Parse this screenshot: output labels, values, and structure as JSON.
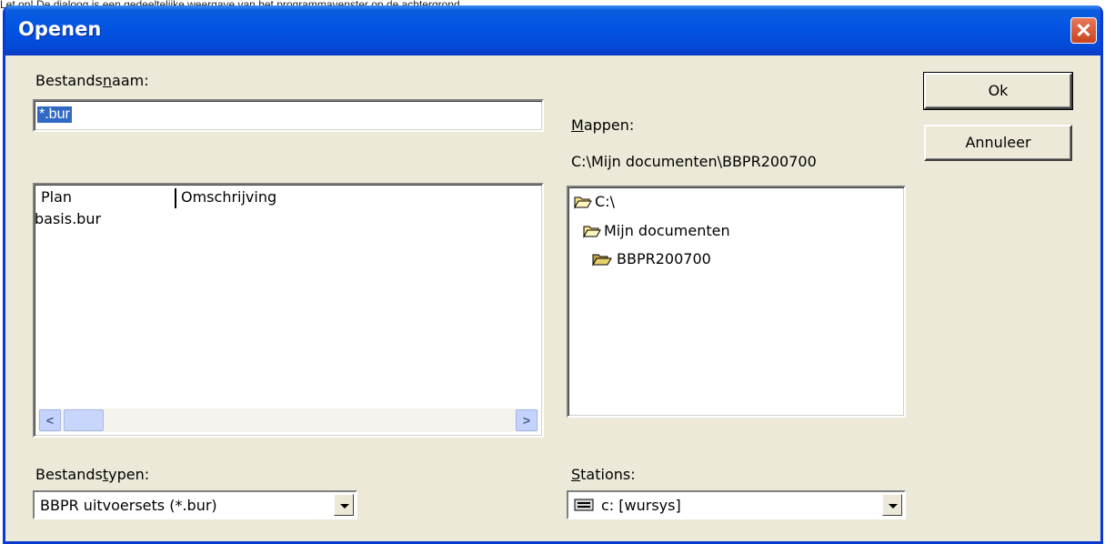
{
  "top_strip_text": "Let op! De dialoog is een gedeeltelijke weergave van het programmavenster op de achtergrond",
  "window": {
    "title": "Openen"
  },
  "filename": {
    "label_pre": "Bestands",
    "label_u": "n",
    "label_post": "aam:",
    "value": "*.bur"
  },
  "file_list": {
    "columns": [
      "Plan",
      "Omschrijving"
    ],
    "rows": [
      {
        "plan": "basis.bur",
        "omschrijving": ""
      }
    ]
  },
  "folders": {
    "label_u": "M",
    "label_post": "appen:",
    "current_path": "C:\\Mijn documenten\\BBPR200700",
    "tree": [
      {
        "label": "C:\\",
        "icon": "open-folder-icon"
      },
      {
        "label": "Mijn documenten",
        "icon": "open-folder-icon"
      },
      {
        "label": "BBPR200700",
        "icon": "open-folder-icon"
      }
    ]
  },
  "buttons": {
    "ok": "Ok",
    "cancel": "Annuleer"
  },
  "filetype": {
    "label_pre": "Bestands",
    "label_u": "t",
    "label_post": "ypen:",
    "value": "BBPR uitvoersets (*.bur)"
  },
  "drives": {
    "label_u": "S",
    "label_post": "tations:",
    "value": "c: [wursys]",
    "icon": "drive-icon"
  },
  "colors": {
    "titlebar": "#0354e4",
    "selection": "#316ac5",
    "dialog_bg": "#ece9d8",
    "close": "#d9542c"
  }
}
